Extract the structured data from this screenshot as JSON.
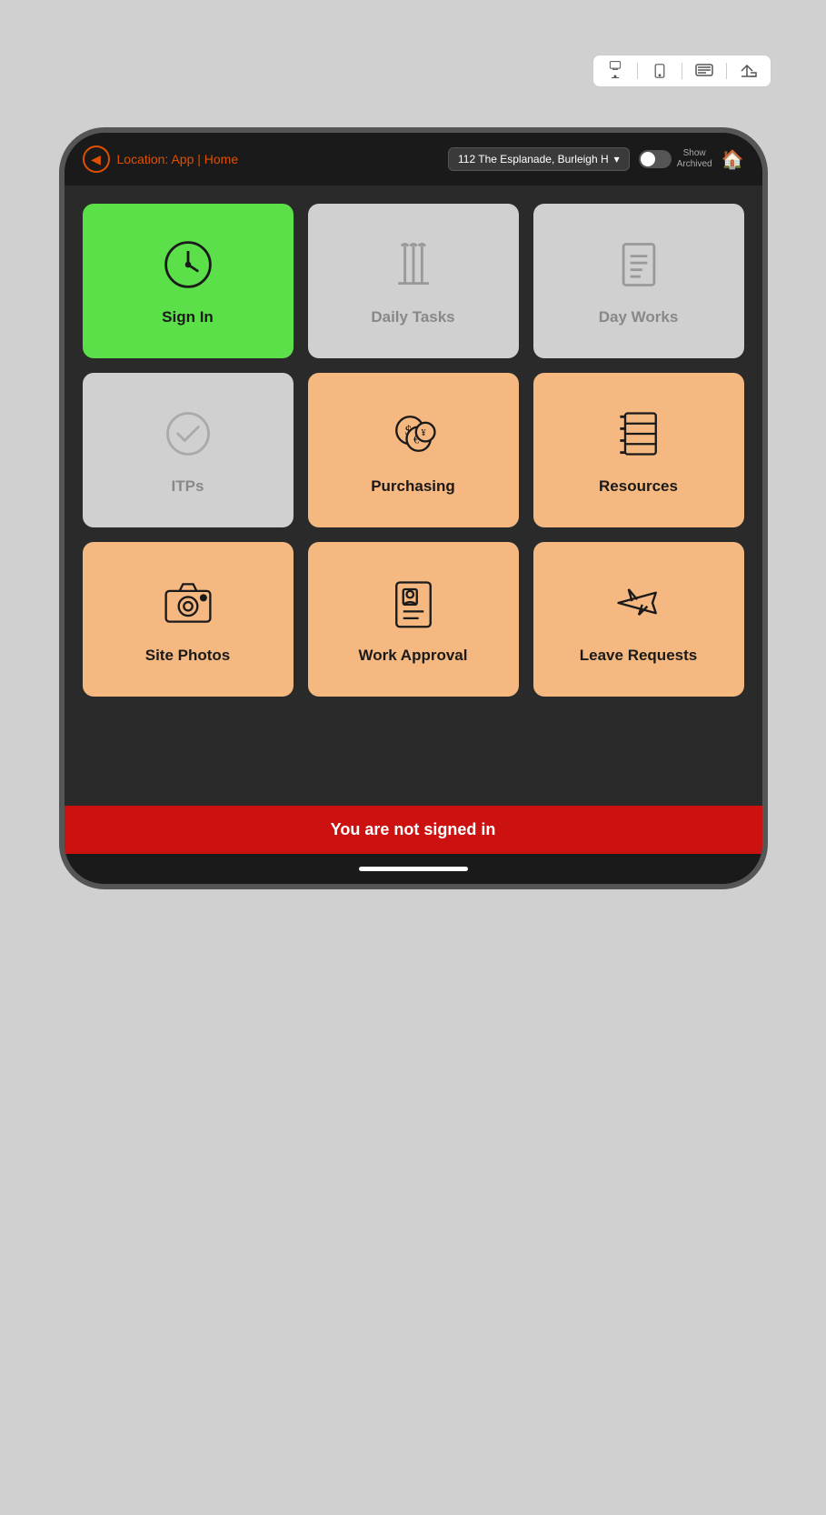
{
  "toolbar": {
    "btn1_label": "screen",
    "btn2_label": "device",
    "btn3_label": "display",
    "btn4_label": "export"
  },
  "header": {
    "back_label": "←",
    "location_prefix": "Location:",
    "location_path": "App | Home",
    "dropdown_value": "112 The Esplanade, Burleigh H",
    "toggle_label": "Show\nArchived",
    "home_icon": "🏠"
  },
  "grid": {
    "tiles": [
      {
        "id": "sign-in",
        "label": "Sign In",
        "style": "green",
        "icon": "clock"
      },
      {
        "id": "daily-tasks",
        "label": "Daily Tasks",
        "style": "gray",
        "icon": "tools"
      },
      {
        "id": "day-works",
        "label": "Day Works",
        "style": "gray",
        "icon": "document"
      },
      {
        "id": "itps",
        "label": "ITPs",
        "style": "gray",
        "icon": "check"
      },
      {
        "id": "purchasing",
        "label": "Purchasing",
        "style": "orange",
        "icon": "coins"
      },
      {
        "id": "resources",
        "label": "Resources",
        "style": "orange",
        "icon": "notebook"
      },
      {
        "id": "site-photos",
        "label": "Site Photos",
        "style": "orange",
        "icon": "camera"
      },
      {
        "id": "work-approval",
        "label": "Work Approval",
        "style": "orange",
        "icon": "id-card"
      },
      {
        "id": "leave-requests",
        "label": "Leave Requests",
        "style": "orange",
        "icon": "plane"
      }
    ]
  },
  "footer": {
    "status_text": "You are not signed in"
  },
  "colors": {
    "green": "#5be04a",
    "gray_tile": "#d0d0d0",
    "orange_tile": "#f5b880",
    "accent": "#e05000",
    "status_bar": "#cc1111"
  }
}
